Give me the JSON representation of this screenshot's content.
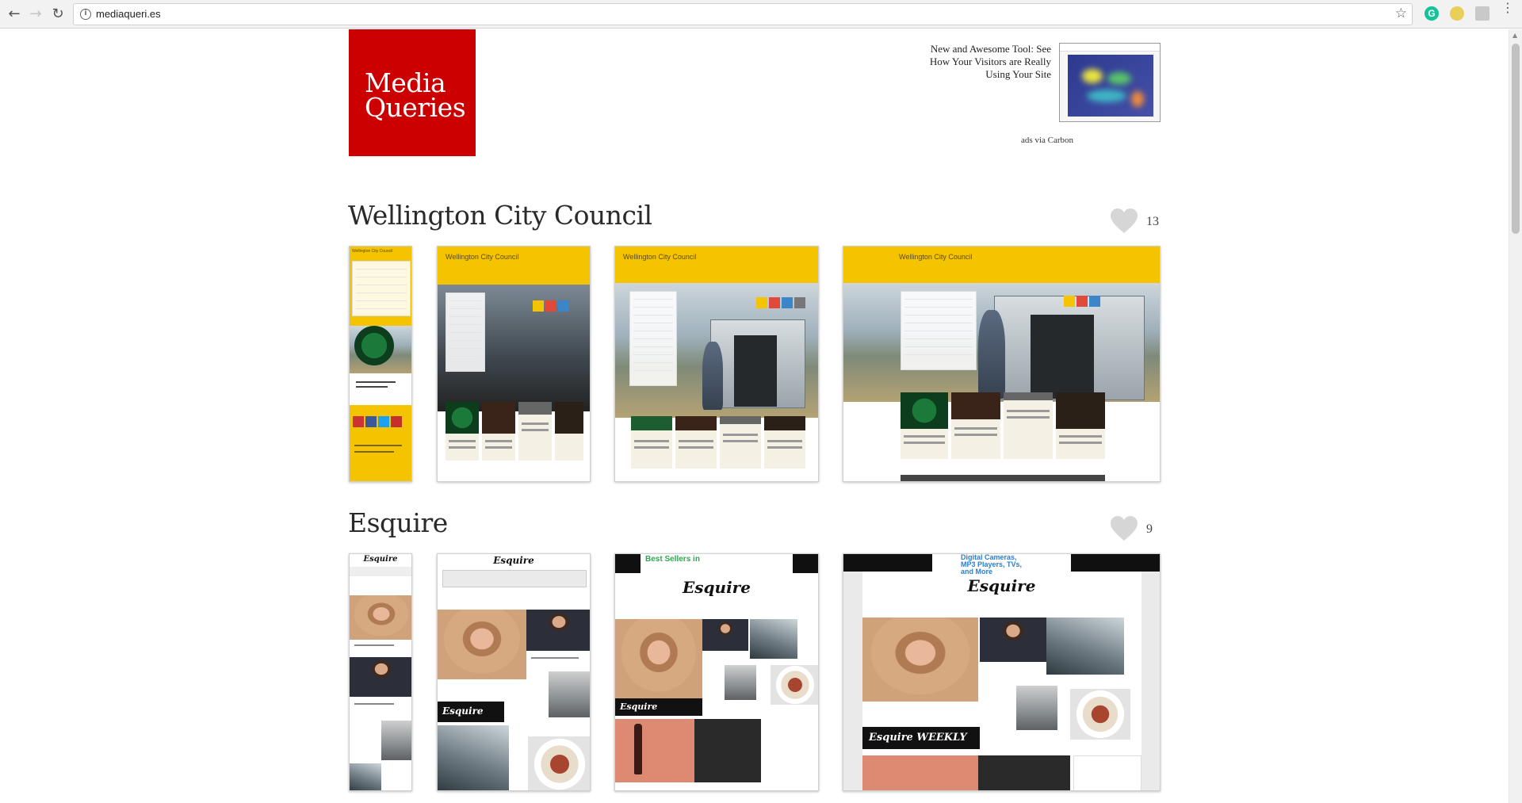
{
  "browser": {
    "url": "mediaqueri.es",
    "back_icon": "arrow-left-icon",
    "forward_icon": "arrow-right-icon",
    "reload_icon": "reload-icon",
    "bookmark_icon": "star-icon",
    "extension_g_label": "G"
  },
  "header": {
    "logo_line1": "Media",
    "logo_line2": "Queries",
    "logo_color": "#cc0000",
    "ad_text": "New and Awesome Tool: See How Your Visitors are Really Using Your Site",
    "ad_caption": "ads via Carbon"
  },
  "sections": [
    {
      "title": "Wellington City Council",
      "likes": "13",
      "screenshots": [
        {
          "name": "mobile",
          "site_title": "Wellington City Council"
        },
        {
          "name": "tablet-portrait",
          "site_title": "Wellington City Council"
        },
        {
          "name": "tablet-landscape",
          "site_title": "Wellington City Council"
        },
        {
          "name": "desktop",
          "site_title": "Wellington City Council"
        }
      ],
      "accent": "#f5c400"
    },
    {
      "title": "Esquire",
      "likes": "9",
      "screenshots": [
        {
          "name": "mobile",
          "masthead": "Esquire"
        },
        {
          "name": "tablet-portrait",
          "masthead": "Esquire"
        },
        {
          "name": "tablet-landscape",
          "masthead": "Esquire",
          "ad": "Best Sellers in"
        },
        {
          "name": "desktop",
          "masthead": "Esquire",
          "ad": "Digital Cameras, MP3 Players, TVs, and More"
        }
      ],
      "weekly_label": "Esquire WEEKLY"
    }
  ]
}
